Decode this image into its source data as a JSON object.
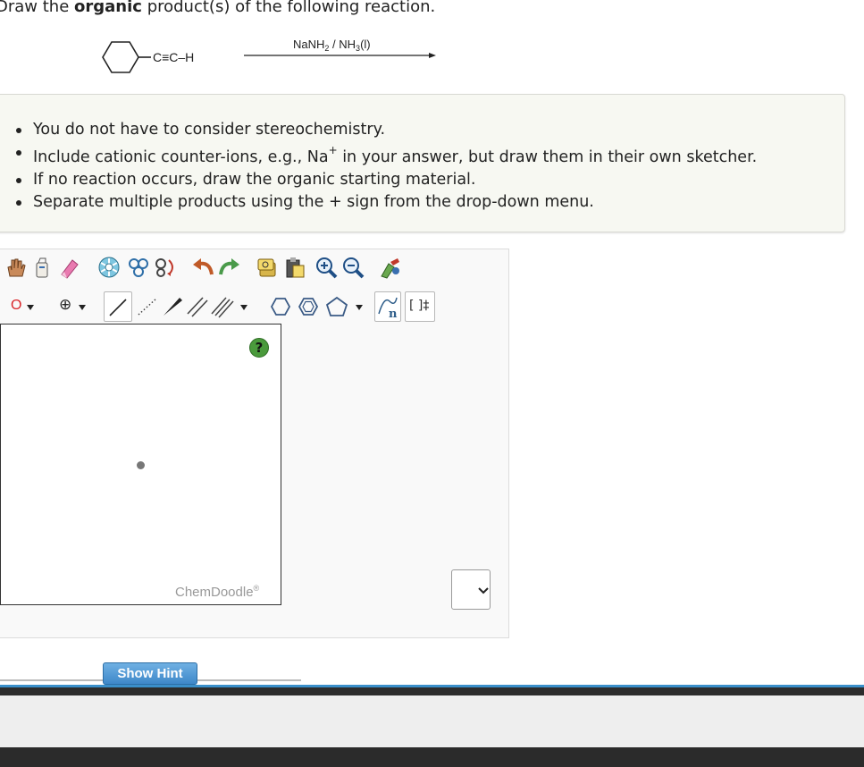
{
  "question": {
    "prefix": "Draw the",
    "bold": "organic",
    "suffix": "product(s) of the following reaction."
  },
  "reaction": {
    "substituent": "C≡C–H",
    "reagent_main": "NaNH",
    "reagent_sub2": "2",
    "reagent_mid": " / NH",
    "reagent_sub3": "3",
    "reagent_end": "(l)"
  },
  "instructions": {
    "item1": "You do not have to consider stereochemistry.",
    "item2_pre": "Include cationic counter-ions, e.g., Na",
    "item2_sup": "+",
    "item2_post": " in your answer, but draw them in their own sketcher.",
    "item3": "If no reaction occurs, draw the organic starting material.",
    "item4": "Separate multiple products using the + sign from the drop-down menu."
  },
  "toolbar": {
    "element_label": "O",
    "charge_label": "⊕",
    "template_label": "[ ]‡"
  },
  "canvas": {
    "help_label": "?",
    "brand": "ChemDoodle",
    "brand_mark": "®"
  },
  "hint": {
    "label": "Show Hint"
  },
  "colors": {
    "accent": "#3a8fca",
    "help": "#4a9a3c",
    "element": "#d9262a"
  }
}
